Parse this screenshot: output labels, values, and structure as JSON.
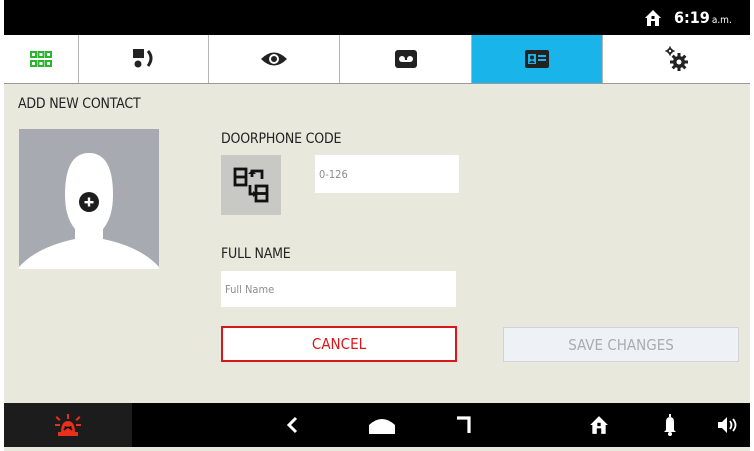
{
  "status_bar": {
    "home_icon": "home-icon",
    "time": "6:19",
    "meridiem": "a.m."
  },
  "tabs": [
    {
      "icon": "grid-icon",
      "active": false,
      "color": "#2bb52f"
    },
    {
      "icon": "intercom-call-icon",
      "active": false
    },
    {
      "icon": "eye-icon",
      "active": false
    },
    {
      "icon": "voicemail-icon",
      "active": false
    },
    {
      "icon": "contact-card-icon",
      "active": true
    },
    {
      "icon": "settings-gears-icon",
      "active": false
    }
  ],
  "page": {
    "title": "ADD NEW CONTACT",
    "avatar_icon": "add-contact-avatar-icon"
  },
  "form": {
    "doorphone_code_label": "DOORPHONE CODE",
    "doorphone_code_placeholder": "0-126",
    "doorphone_code_value": "",
    "code_icon": "code-transfer-icon",
    "full_name_label": "FULL NAME",
    "full_name_placeholder": "Full Name",
    "full_name_value": ""
  },
  "buttons": {
    "cancel_label": "CANCEL",
    "save_label": "SAVE CHANGES"
  },
  "bottom_bar": {
    "icons": [
      "alarm-icon",
      "back-icon",
      "home-nav-icon",
      "recent-apps-icon",
      "home-icon",
      "bell-icon",
      "volume-icon"
    ]
  },
  "colors": {
    "accent": "#18b4ea",
    "cancel_red": "#d81818",
    "alarm_red": "#e8301c",
    "background": "#e9e8dc"
  }
}
